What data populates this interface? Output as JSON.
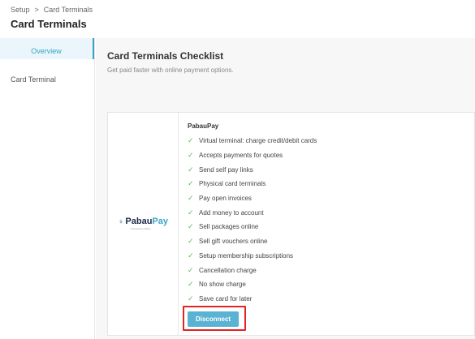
{
  "breadcrumb": {
    "parent": "Setup",
    "separator": ">",
    "current": "Card Terminals"
  },
  "page_title": "Card Terminals",
  "sidebar": {
    "items": [
      {
        "label": "Overview",
        "active": true
      },
      {
        "label": "Card Terminal",
        "active": false
      }
    ]
  },
  "section": {
    "title": "Card Terminals Checklist",
    "subtitle": "Get paid faster with online payment options."
  },
  "provider": {
    "name": "PabauPay",
    "logo_text_a": "Pabau",
    "logo_text_b": "Pay",
    "logo_tagline": "Powered by Stripe",
    "features": [
      "Virtual terminal: charge credit/debit cards",
      "Accepts payments for quotes",
      "Send self pay links",
      "Physical card terminals",
      "Pay open invoices",
      "Add money to account",
      "Sell packages online",
      "Sell gift vouchers online",
      "Setup membership subscriptions",
      "Cancellation charge",
      "No show charge",
      "Save card for later"
    ],
    "button_label": "Disconnect"
  },
  "colors": {
    "accent": "#3aa3c9",
    "button": "#5bb3d3",
    "check": "#5cb85c",
    "highlight": "#e02424"
  }
}
